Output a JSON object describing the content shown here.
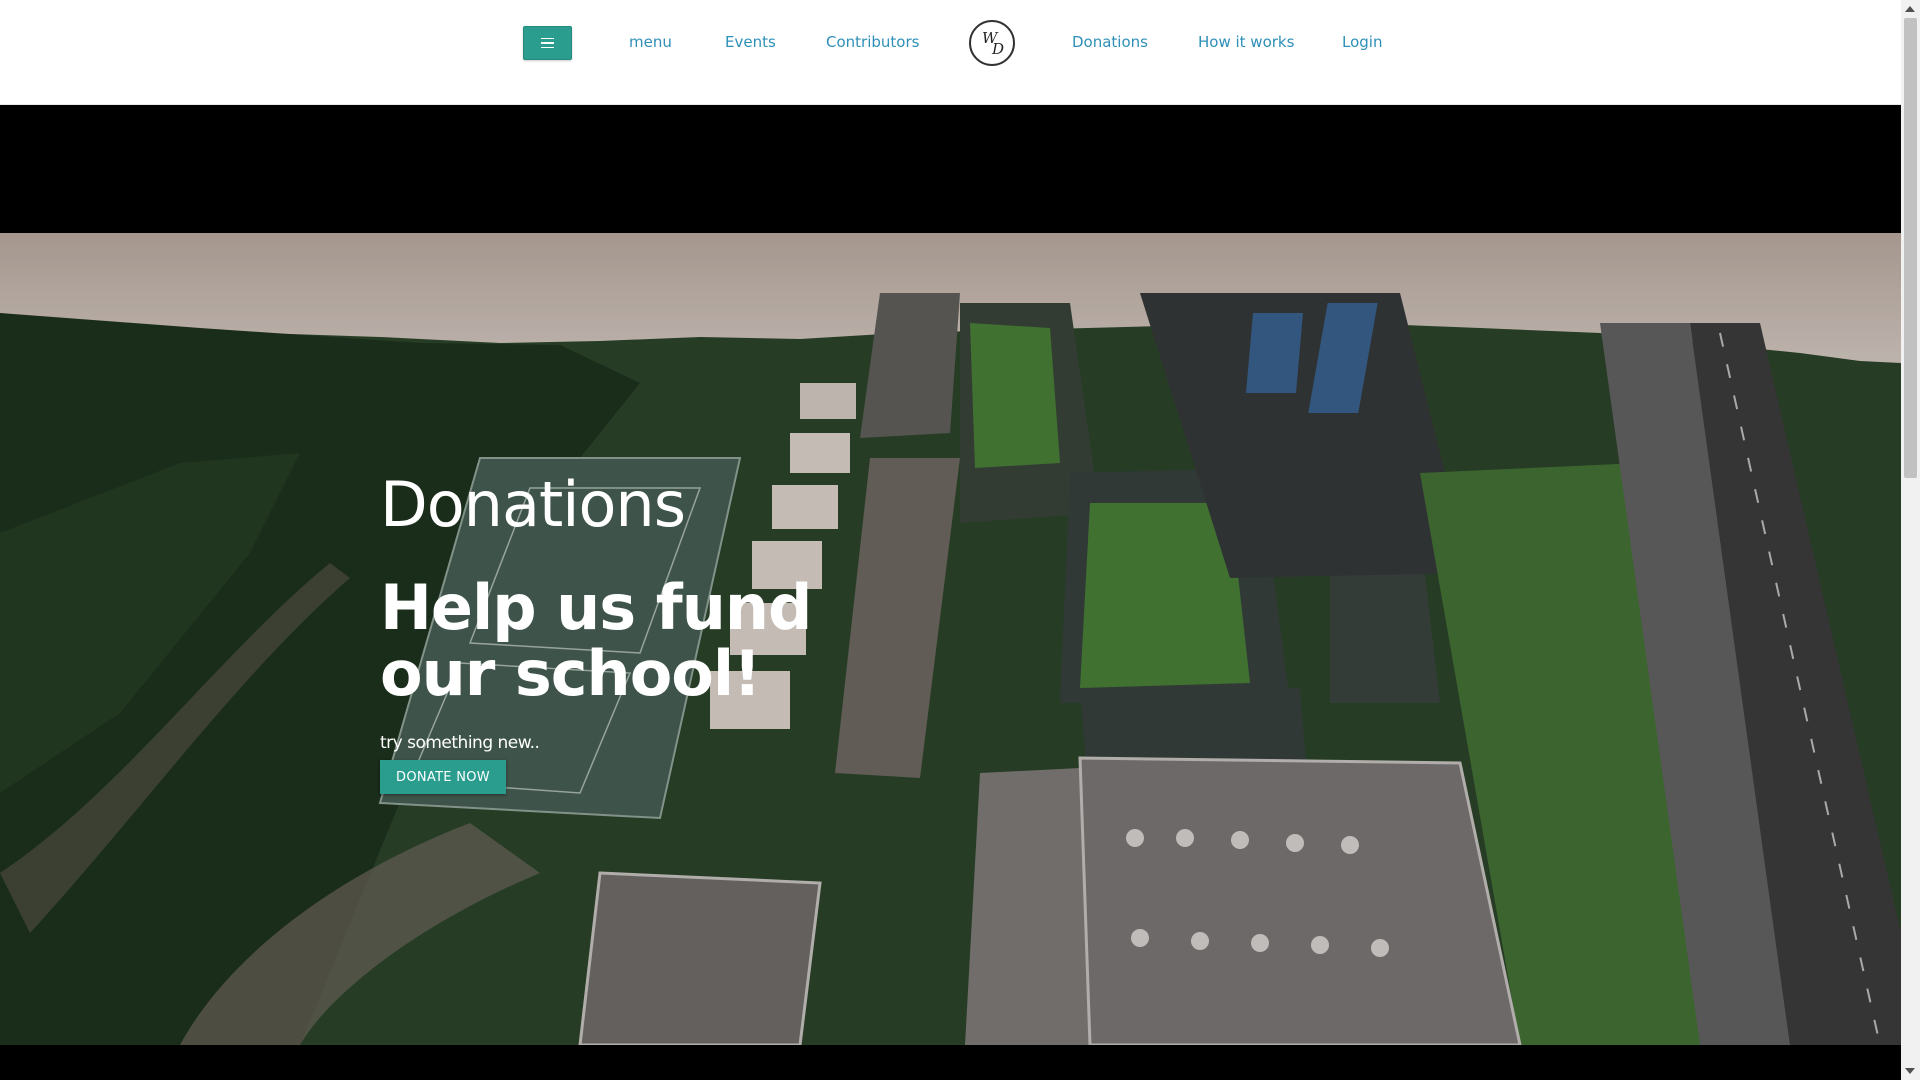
{
  "nav": {
    "menu_icon": "hamburger-menu-icon",
    "items": [
      {
        "label": "menu"
      },
      {
        "label": "Events"
      },
      {
        "label": "Contributors"
      },
      {
        "label": "Donations"
      },
      {
        "label": "How it works"
      },
      {
        "label": "Login"
      }
    ],
    "logo": {
      "letter1": "W",
      "letter2": "D"
    }
  },
  "hero": {
    "title": "Donations",
    "subtitle": "Help us fund our school!",
    "tagline": "try something new..",
    "button_label": "DONATE NOW"
  },
  "colors": {
    "accent": "#2a9d8f",
    "link": "#2e8fb8"
  }
}
